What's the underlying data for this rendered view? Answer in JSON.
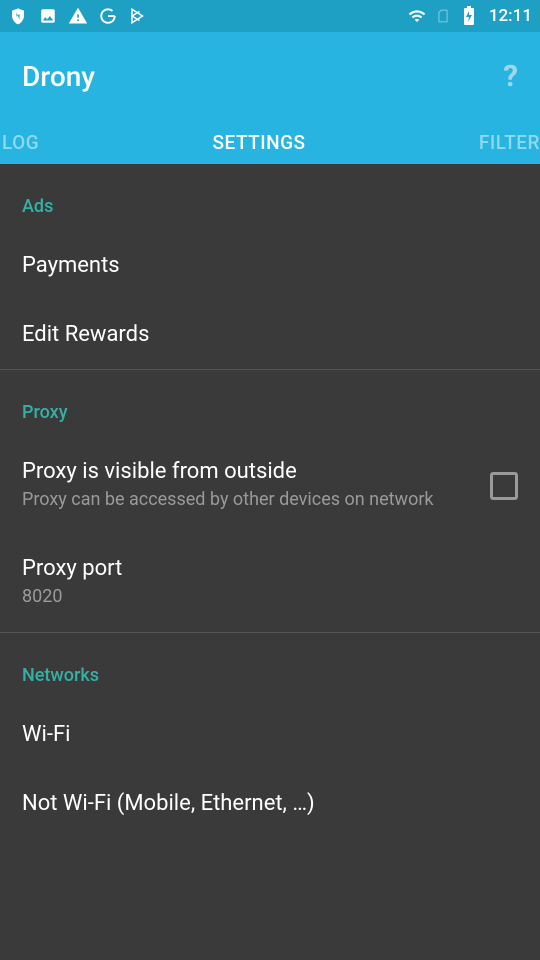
{
  "status_bar": {
    "time": "12:11"
  },
  "app_bar": {
    "title": "Drony",
    "help": "?"
  },
  "tabs": {
    "log": "LOG",
    "settings": "SETTINGS",
    "filter": "FILTER"
  },
  "sections": {
    "ads": {
      "header": "Ads",
      "payments": "Payments",
      "edit_rewards": "Edit Rewards"
    },
    "proxy": {
      "header": "Proxy",
      "visible_title": "Proxy is visible from outside",
      "visible_subtitle": "Proxy can be accessed by other devices on network",
      "port_title": "Proxy port",
      "port_value": "8020"
    },
    "networks": {
      "header": "Networks",
      "wifi": "Wi-Fi",
      "not_wifi": "Not Wi-Fi (Mobile, Ethernet, …)"
    }
  }
}
